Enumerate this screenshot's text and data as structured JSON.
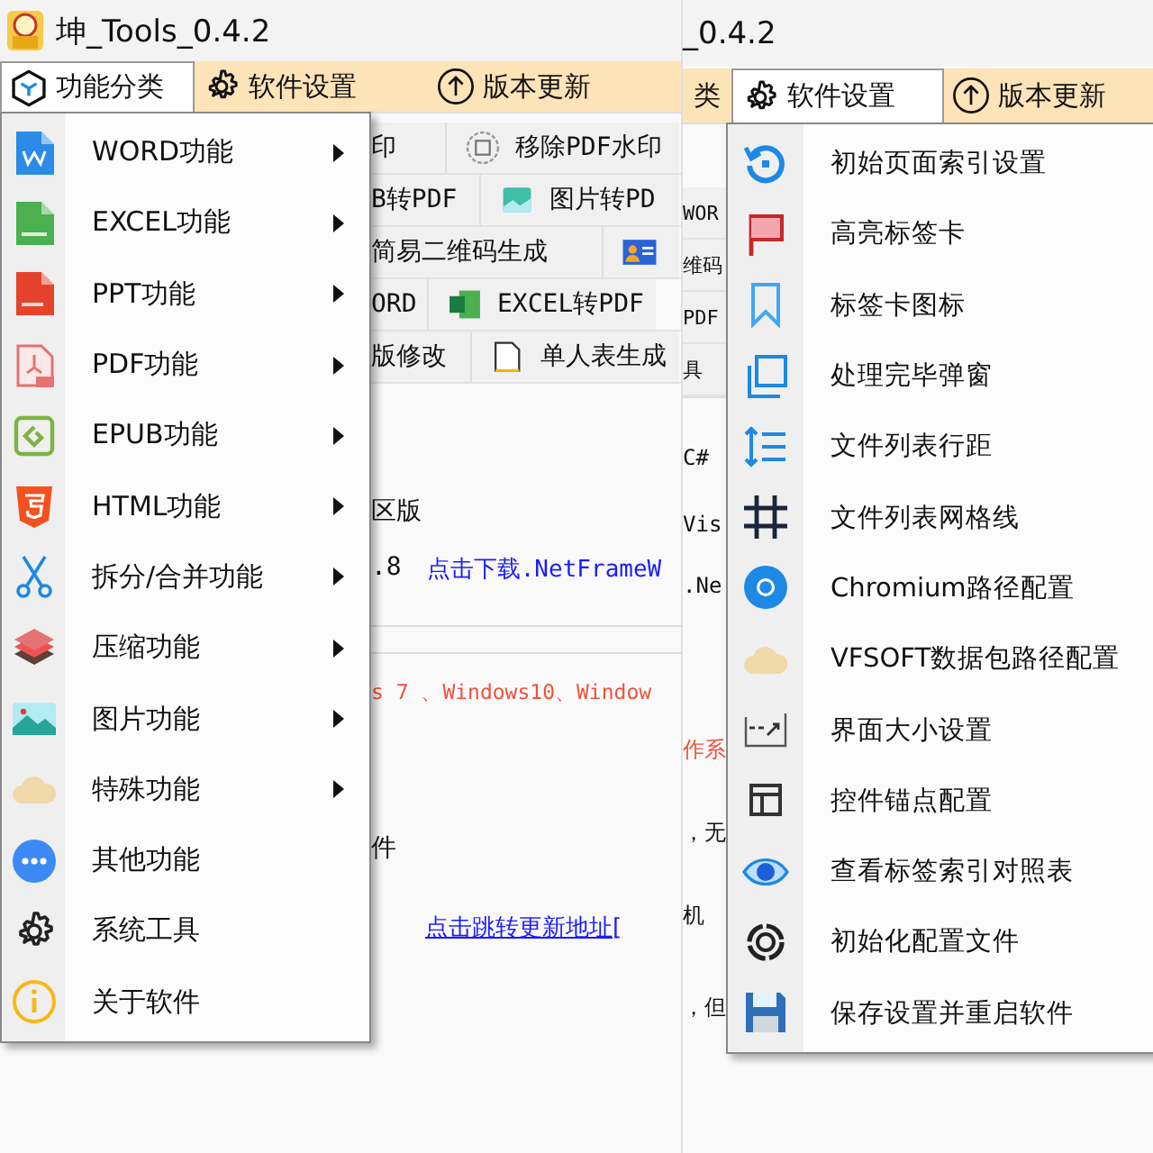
{
  "left_window": {
    "title": "坤_Tools_0.4.2",
    "menu_bar": [
      {
        "label": "功能分类",
        "selected": true
      },
      {
        "label": "软件设置",
        "selected": false
      },
      {
        "label": "版本更新",
        "selected": false
      }
    ],
    "toolbar_rows": [
      [
        "印",
        "移除PDF水印"
      ],
      [
        "B转PDF",
        "图片转PD"
      ],
      [
        "简易二维码生成",
        ""
      ],
      [
        "ORD",
        "EXCEL转PDF"
      ],
      [
        "版修改",
        "单人表生成"
      ]
    ],
    "content_lines": [
      [
        {
          "kind": "plain",
          "text": "区版"
        }
      ],
      [
        {
          "kind": "plain",
          "text": ".8"
        },
        {
          "kind": "link",
          "text": "点击下载.NetFrameW"
        }
      ],
      [
        {
          "kind": "warning",
          "text": "s 7 、Windows10、Window"
        }
      ],
      [
        {
          "kind": "plain",
          "text": "件"
        }
      ],
      [
        {
          "kind": "link",
          "text": "点击跳转更新地址["
        }
      ]
    ],
    "menu": [
      {
        "label": "WORD功能",
        "submenu": true
      },
      {
        "label": "EXCEL功能",
        "submenu": true
      },
      {
        "label": "PPT功能",
        "submenu": true
      },
      {
        "label": "PDF功能",
        "submenu": true
      },
      {
        "label": "EPUB功能",
        "submenu": true
      },
      {
        "label": "HTML功能",
        "submenu": true
      },
      {
        "label": "拆分/合并功能",
        "submenu": true
      },
      {
        "label": "压缩功能",
        "submenu": true
      },
      {
        "label": "图片功能",
        "submenu": true
      },
      {
        "label": "特殊功能",
        "submenu": true
      },
      {
        "label": "其他功能",
        "submenu": false
      },
      {
        "label": "系统工具",
        "submenu": false
      },
      {
        "label": "关于软件",
        "submenu": false
      }
    ]
  },
  "right_window": {
    "title": "_0.4.2",
    "menu_bar": [
      {
        "label": "类",
        "selected": false
      },
      {
        "label": "软件设置",
        "selected": true
      },
      {
        "label": "版本更新",
        "selected": false
      }
    ],
    "toolbar_cells": [
      "WOR",
      "维码",
      "PDF",
      "具"
    ],
    "content_lines": [
      {
        "kind": "plain",
        "text": "C#"
      },
      {
        "kind": "plain",
        "text": "Vis"
      },
      {
        "kind": "plain",
        "text": ".Ne"
      },
      {
        "kind": "warning",
        "text": "作系"
      },
      {
        "kind": "plain",
        "text": "，无"
      },
      {
        "kind": "plain",
        "text": "机"
      },
      {
        "kind": "plain",
        "text": "，但"
      }
    ],
    "menu": [
      {
        "label": "初始页面索引设置"
      },
      {
        "label": "高亮标签卡"
      },
      {
        "label": "标签卡图标"
      },
      {
        "label": "处理完毕弹窗"
      },
      {
        "label": "文件列表行距"
      },
      {
        "label": "文件列表网格线"
      },
      {
        "label": "Chromium路径配置"
      },
      {
        "label": "VFSOFT数据包路径配置"
      },
      {
        "label": "界面大小设置"
      },
      {
        "label": "控件锚点配置"
      },
      {
        "label": "查看标签索引对照表"
      },
      {
        "label": "初始化配置文件"
      },
      {
        "label": "保存设置并重启软件"
      }
    ]
  }
}
